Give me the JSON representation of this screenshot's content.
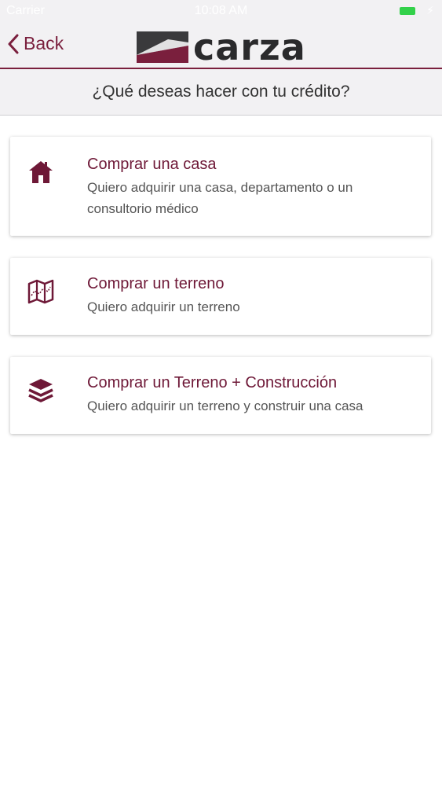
{
  "status_bar": {
    "carrier": "Carrier",
    "time": "10:08 AM"
  },
  "nav": {
    "back_label": "Back",
    "logo_text": "carza"
  },
  "header": {
    "question": "¿Qué deseas hacer con tu crédito?"
  },
  "options": [
    {
      "title": "Comprar una casa",
      "description": "Quiero adquirir una casa, departamento o un consultorio médico",
      "icon": "house-icon"
    },
    {
      "title": "Comprar un terreno",
      "description": "Quiero adquirir un terreno",
      "icon": "map-icon"
    },
    {
      "title": "Comprar un Terreno + Construcción",
      "description": "Quiero adquirir un terreno y construir una casa",
      "icon": "layers-icon"
    }
  ],
  "colors": {
    "accent": "#7a1f3d",
    "title": "#6e1837",
    "background": "#ffffff",
    "bar": "#f2f1f3",
    "battery": "#33d14a"
  }
}
